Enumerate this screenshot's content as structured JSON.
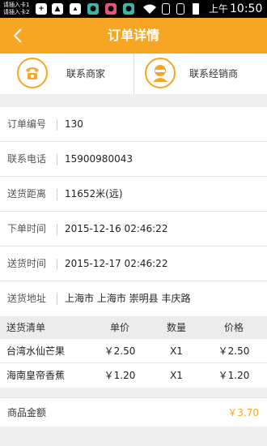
{
  "status_bar": {
    "sim1": "请插入卡1",
    "sim2": "请插入卡2",
    "am_pm": "上午",
    "time": "10:50"
  },
  "header": {
    "title": "订单详情"
  },
  "contacts": {
    "merchant_label": "联系商家",
    "dealer_label": "联系经销商"
  },
  "details": [
    {
      "label": "订单编号",
      "value": "130"
    },
    {
      "label": "联系电话",
      "value": "15900980043"
    },
    {
      "label": "送货距离",
      "value": "11652米(远)"
    },
    {
      "label": "下单时间",
      "value": "2015-12-16 02:46:22"
    },
    {
      "label": "送货时间",
      "value": "2015-12-17 02:46:22"
    },
    {
      "label": "送货地址",
      "value": "上海市 上海市 崇明县 丰庆路"
    }
  ],
  "products": {
    "headers": [
      "送货清单",
      "单价",
      "数量",
      "价格"
    ],
    "rows": [
      [
        "台湾水仙芒果",
        "￥2.50",
        "X1",
        "￥2.50"
      ],
      [
        "海南皇帝香蕉",
        "￥1.20",
        "X1",
        "￥1.20"
      ]
    ]
  },
  "total": {
    "label": "商品金额",
    "value": "￥3.70"
  },
  "colors": {
    "accent": "#f6a623"
  }
}
